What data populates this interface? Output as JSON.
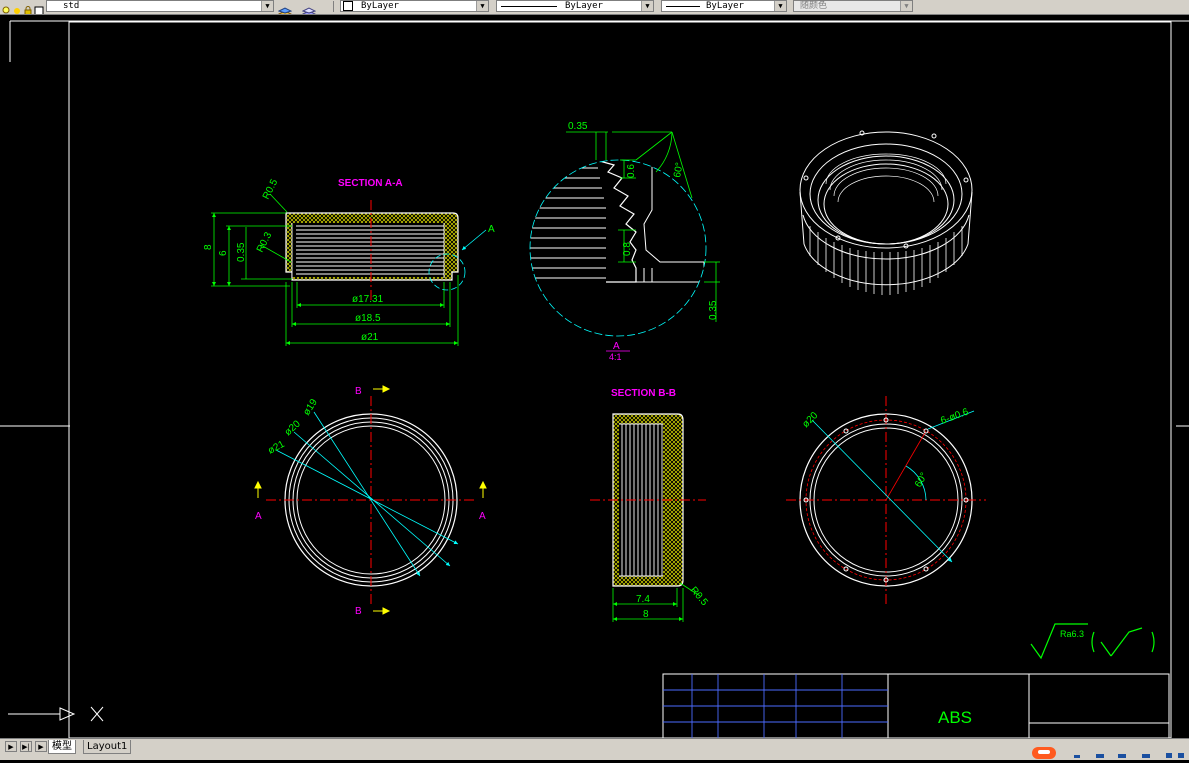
{
  "toolbar": {
    "layer_name": "std",
    "color_value": "ByLayer",
    "linetype_value": "ByLayer",
    "lineweight_value": "ByLayer",
    "plotstyle_value": "随颜色"
  },
  "tabs": {
    "model": "模型",
    "layout1": "Layout1"
  },
  "drawing": {
    "section_aa": "SECTION A-A",
    "section_bb": "SECTION B-B",
    "dim_r05": "R0.5",
    "dim_r03": "R0.3",
    "dim_8": "8",
    "dim_6": "6",
    "dim_035": "0.35",
    "dim_phi1731": "ø17.31",
    "dim_phi185": "ø18.5",
    "dim_phi21": "ø21",
    "label_a": "A",
    "detail_035_top": "0.35",
    "detail_06": "0.6",
    "detail_60deg": "60°",
    "detail_08": "0.8",
    "detail_035_right": "0.35",
    "detail_label": "A",
    "detail_scale": "4:1",
    "label_b": "B",
    "circle_phi19": "ø19",
    "circle_phi20": "ø20",
    "circle_phi21": "ø21",
    "bb_74": "7.4",
    "bb_8": "8",
    "bb_r05": "R0.5",
    "right_phi20": "ø20",
    "right_holes": "6-ø0.6",
    "right_60deg": "60°",
    "ra_value": "Ra6.3",
    "material": "ABS"
  },
  "colors": {
    "background": "#000000",
    "dimension": "#00ff00",
    "title_magenta": "#ff00ff",
    "center_red": "#ff0000",
    "leader_cyan": "#00ffff",
    "hatch_yellow": "#ffff00",
    "geometry_white": "#ffffff",
    "frame_blue": "#4d6bff"
  }
}
